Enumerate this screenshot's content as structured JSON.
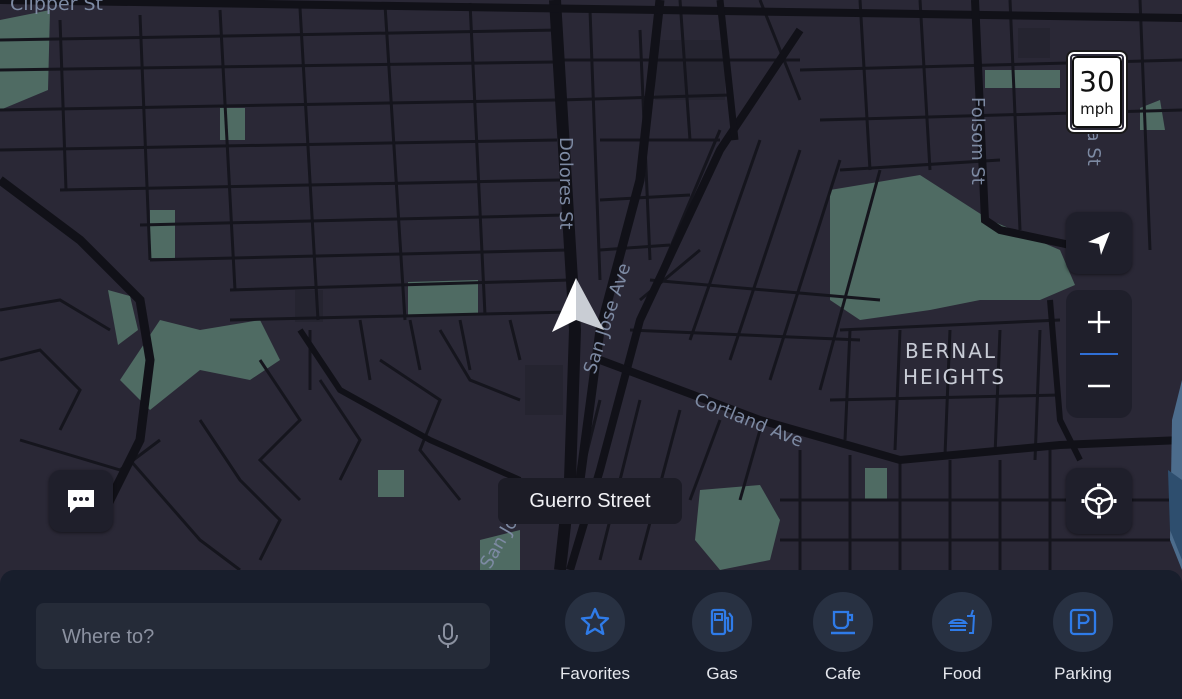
{
  "map": {
    "street_labels": [
      "Clipper St",
      "Dolores St",
      "San Jose Ave",
      "Folsom St",
      "Cortland Ave",
      "San Jose",
      "ma St"
    ],
    "area_label_line1": "BERNAL",
    "area_label_line2": "HEIGHTS"
  },
  "speed_limit": {
    "value": "30",
    "unit": "mph"
  },
  "current_street": "Guerro Street",
  "search": {
    "placeholder": "Where to?",
    "value": ""
  },
  "shortcuts": [
    {
      "label": "Favorites",
      "icon": "star-icon"
    },
    {
      "label": "Gas",
      "icon": "gas-pump-icon"
    },
    {
      "label": "Cafe",
      "icon": "coffee-cup-icon"
    },
    {
      "label": "Food",
      "icon": "burger-drink-icon"
    },
    {
      "label": "Parking",
      "icon": "parking-icon"
    }
  ],
  "controls": {
    "recenter_icon": "navigation-arrow-icon",
    "zoom_in_icon": "plus-icon",
    "zoom_out_icon": "minus-icon",
    "settings_icon": "steering-wheel-icon",
    "messages_icon": "chat-bubble-icon"
  },
  "colors": {
    "map_bg": "#2a2836",
    "park": "#4f6b63",
    "road": "#15151d",
    "accent": "#2f7be8",
    "panel": "#181e2c"
  }
}
